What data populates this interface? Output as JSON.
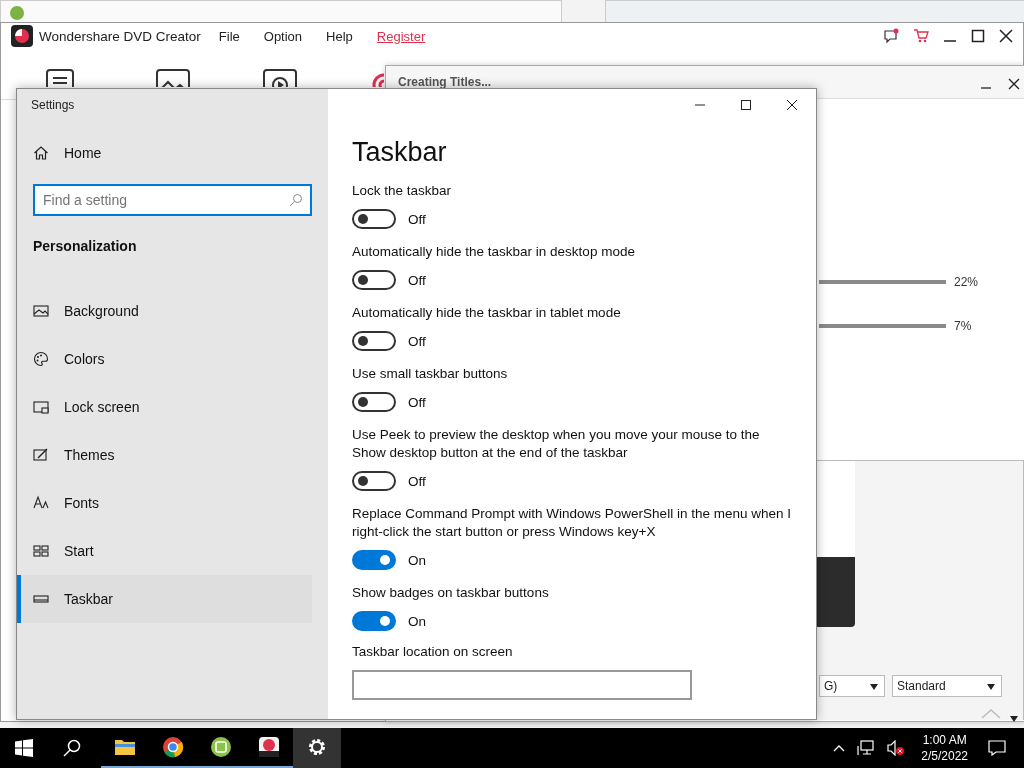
{
  "app_window": {
    "title": "Wondershare DVD Creator",
    "menu": [
      {
        "label": "File",
        "kind": "menu"
      },
      {
        "label": "Option",
        "kind": "menu"
      },
      {
        "label": "Help",
        "kind": "menu"
      },
      {
        "label": "Register",
        "kind": "link"
      }
    ]
  },
  "progress_dialog": {
    "title": "Creating Titles...",
    "progress": [
      {
        "reading": "22%"
      },
      {
        "reading": "7%"
      }
    ],
    "dropdowns": [
      {
        "value": "G)"
      },
      {
        "value": "Standard"
      }
    ]
  },
  "settings": {
    "title": "Settings",
    "home": "Home",
    "search": {
      "placeholder": "Find a setting"
    },
    "section": "Personalization",
    "nav": [
      {
        "label": "Background",
        "kind": "background",
        "selected": false
      },
      {
        "label": "Colors",
        "kind": "colors",
        "selected": false
      },
      {
        "label": "Lock screen",
        "kind": "lockscreen",
        "selected": false
      },
      {
        "label": "Themes",
        "kind": "themes",
        "selected": false
      },
      {
        "label": "Fonts",
        "kind": "fonts",
        "selected": false
      },
      {
        "label": "Start",
        "kind": "start",
        "selected": false
      },
      {
        "label": "Taskbar",
        "kind": "taskbar",
        "selected": true
      }
    ],
    "page_title": "Taskbar",
    "options": [
      {
        "label": "Lock the taskbar",
        "on": false,
        "state_text": "Off"
      },
      {
        "label": "Automatically hide the taskbar in desktop mode",
        "on": false,
        "state_text": "Off"
      },
      {
        "label": "Automatically hide the taskbar in tablet mode",
        "on": false,
        "state_text": "Off"
      },
      {
        "label": "Use small taskbar buttons",
        "on": false,
        "state_text": "Off"
      },
      {
        "label": "Use Peek to preview the desktop when you move your mouse to the Show desktop button at the end of the taskbar",
        "on": false,
        "state_text": "Off"
      },
      {
        "label": "Replace Command Prompt with Windows PowerShell in the menu when I right-click the start button or press Windows key+X",
        "on": true,
        "state_text": "On"
      },
      {
        "label": "Show badges on taskbar buttons",
        "on": true,
        "state_text": "On"
      }
    ],
    "last_heading": "Taskbar location on screen"
  },
  "taskbar": {
    "apps": [
      {
        "kind": "folder",
        "selected": false
      },
      {
        "kind": "browser",
        "selected": false
      },
      {
        "kind": "green",
        "selected": false
      },
      {
        "kind": "dvd",
        "selected": false
      },
      {
        "kind": "gear",
        "selected": true
      }
    ],
    "time": "1:00 AM",
    "date": "2/5/2022"
  }
}
